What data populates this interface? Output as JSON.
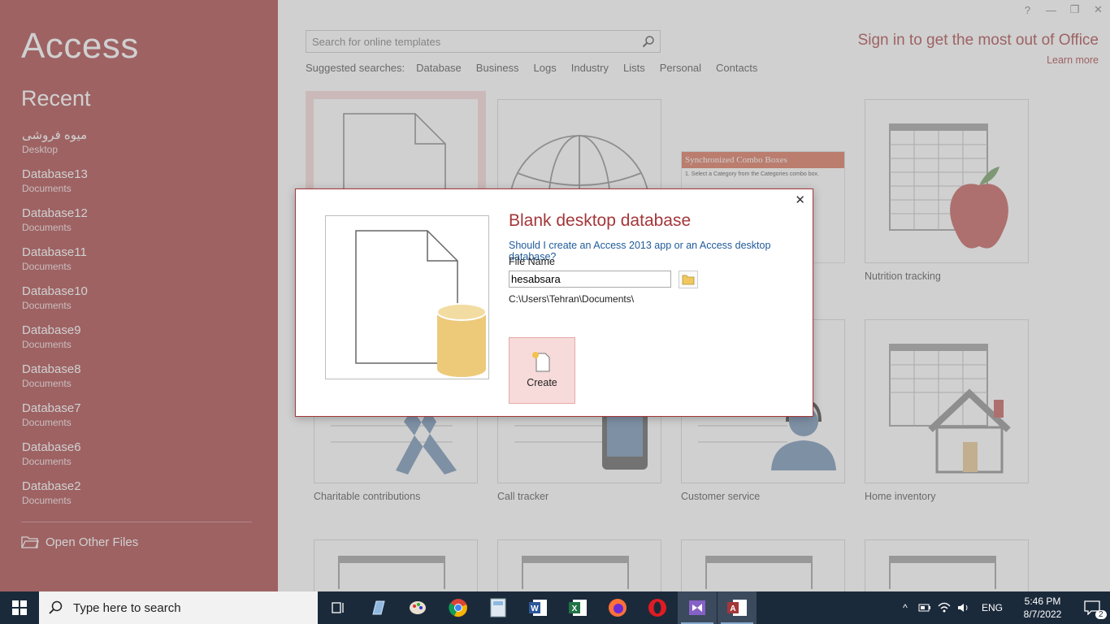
{
  "app": {
    "brand": "Access",
    "recent_heading": "Recent",
    "recent_items": [
      {
        "name": "میوه فروشی",
        "location": "Desktop"
      },
      {
        "name": "Database13",
        "location": "Documents"
      },
      {
        "name": "Database12",
        "location": "Documents"
      },
      {
        "name": "Database11",
        "location": "Documents"
      },
      {
        "name": "Database10",
        "location": "Documents"
      },
      {
        "name": "Database9",
        "location": "Documents"
      },
      {
        "name": "Database8",
        "location": "Documents"
      },
      {
        "name": "Database7",
        "location": "Documents"
      },
      {
        "name": "Database6",
        "location": "Documents"
      },
      {
        "name": "Database2",
        "location": "Documents"
      }
    ],
    "open_other": "Open Other Files",
    "window_controls": [
      "?",
      "—",
      "❐",
      "✕"
    ]
  },
  "main": {
    "search_placeholder": "Search for online templates",
    "suggested_label": "Suggested searches:",
    "suggested": [
      "Database",
      "Business",
      "Logs",
      "Industry",
      "Lists",
      "Personal",
      "Contacts"
    ],
    "signin": "Sign in to get the most out of Office",
    "learn_more": "Learn more",
    "combo_title": "Synchronized Combo Boxes",
    "combo_text": "1. Select a Category from the Categories combo box.",
    "tiles": {
      "nutrition": "Nutrition tracking",
      "charitable": "Charitable contributions",
      "call_tracker": "Call tracker",
      "customer_service": "Customer service",
      "home_inventory": "Home inventory"
    }
  },
  "dialog": {
    "title": "Blank desktop database",
    "question": "Should I create an Access 2013 app or an Access desktop database?",
    "file_name_label": "File Name",
    "file_name_value": "hesabsara",
    "path": "C:\\Users\\Tehran\\Documents\\",
    "create_label": "Create",
    "close": "✕"
  },
  "taskbar": {
    "search_placeholder": "Type here to search",
    "language": "ENG",
    "time": "5:46 PM",
    "date": "8/7/2022",
    "notifications": "2"
  },
  "colors": {
    "accent": "#a4373a",
    "taskbar": "#1b2a3b",
    "link": "#1f5b9a"
  }
}
